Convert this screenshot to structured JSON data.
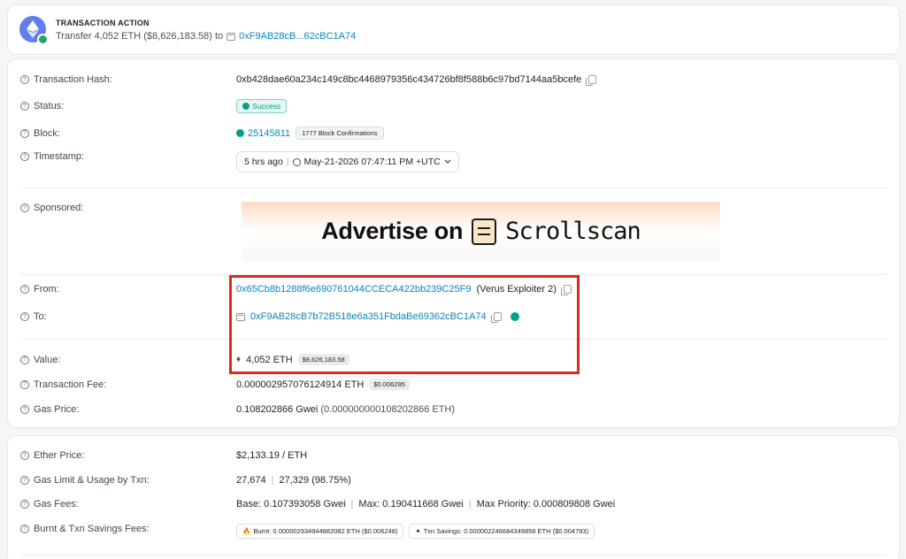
{
  "action": {
    "title": "TRANSACTION ACTION",
    "prefix": "Transfer 4,052 ETH ($8,626,183.58) to",
    "address": "0xF9AB28cB...62cBC1A74"
  },
  "details": {
    "hash": {
      "label": "Transaction Hash:",
      "value": "0xb428dae60a234c149c8bc4468979356c434726bf8f588b6c97bd7144aa5bcefe"
    },
    "status": {
      "label": "Status:",
      "value": "Success"
    },
    "block": {
      "label": "Block:",
      "value": "25145811",
      "confirmations": "1777 Block Confirmations"
    },
    "timestamp": {
      "label": "Timestamp:",
      "ago": "5 hrs ago",
      "date": "May-21-2026 07:47:11 PM +UTC"
    },
    "sponsored": {
      "label": "Sponsored:",
      "ad_text": "Advertise on",
      "ad_brand": "Scrollscan"
    },
    "from": {
      "label": "From:",
      "address": "0x65Cb8b1288f6e690761044CCECA422bb239C25F9",
      "tag": "(Verus Exploiter 2)"
    },
    "to": {
      "label": "To:",
      "address": "0xF9AB28cB7b72B518e6a351FbdaBe69362cBC1A74"
    },
    "value": {
      "label": "Value:",
      "amount": "4,052 ETH",
      "usd": "$8,626,183.58"
    },
    "fee": {
      "label": "Transaction Fee:",
      "amount": "0.000002957076124914 ETH",
      "usd": "$0.006295"
    },
    "gas_price": {
      "label": "Gas Price:",
      "gwei": "0.108202866 Gwei",
      "eth": "(0.000000000108202866 ETH)"
    }
  },
  "more": {
    "ether_price": {
      "label": "Ether Price:",
      "value": "$2,133.19 / ETH"
    },
    "gas_limit": {
      "label": "Gas Limit & Usage by Txn:",
      "limit": "27,674",
      "usage": "27,329 (98.75%)"
    },
    "gas_fees": {
      "label": "Gas Fees:",
      "base": "Base: 0.107393058 Gwei",
      "max": "Max: 0.190411668 Gwei",
      "priority": "Max Priority: 0.000809808 Gwei"
    },
    "burnt": {
      "label": "Burnt & Txn Savings Fees:",
      "burnt": "Burnt: 0.000002934944882082 ETH ($0.006248)",
      "savings": "Txn Savings: 0.000002246684349858 ETH ($0.004783)"
    }
  },
  "icons": {
    "question": "?",
    "eth": "♦",
    "sep": "|",
    "burn": "🔥",
    "savings": "✦"
  }
}
